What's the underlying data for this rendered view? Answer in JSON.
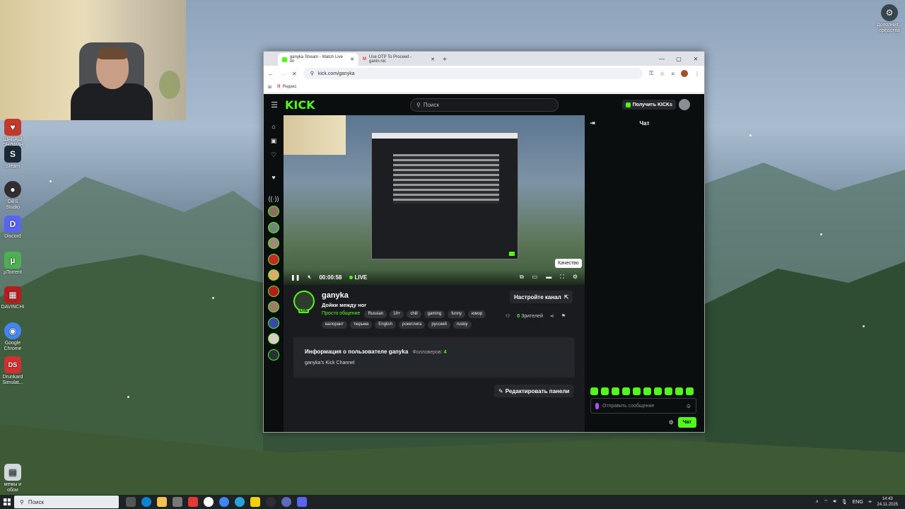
{
  "desktop": {
    "icons": [
      {
        "label": "ШАБАШ ОНЛАЙН",
        "color": "#c0392b",
        "glyph": "♥"
      },
      {
        "label": "Steam",
        "color": "#1b2838",
        "glyph": "S"
      },
      {
        "label": "OBS Studio",
        "color": "#302e31",
        "glyph": "●"
      },
      {
        "label": "Discord",
        "color": "#5865f2",
        "glyph": "D"
      },
      {
        "label": "µTorrent",
        "color": "#4caf50",
        "glyph": "µ"
      },
      {
        "label": "DAVINCHI",
        "color": "#b71c1c",
        "glyph": "▦"
      },
      {
        "label": "Google Chrome",
        "color": "#4285f4",
        "glyph": "◉"
      },
      {
        "label": "Drunkard Simulat...",
        "color": "#d32f2f",
        "glyph": "DS"
      },
      {
        "label": "мемы и обои",
        "color": "#cfd8dc",
        "glyph": "▤"
      },
      {
        "label": "Дополнит... средства",
        "color": "#37474f",
        "glyph": "⚙"
      }
    ]
  },
  "browser": {
    "tabs": [
      {
        "label": "ganyka Stream - Watch Live on",
        "favicon_color": "#53fc18"
      },
      {
        "label": "Use OTP To Proceed - ganin.nic",
        "favicon_color": "#ea4335"
      }
    ],
    "new_tab": "+",
    "window_controls": [
      "—",
      "▢",
      "✕"
    ],
    "url": "kick.com/ganyka",
    "bookmark": "Яндекс"
  },
  "kick": {
    "logo": "KICK",
    "search_placeholder": "Поиск",
    "get_kicks": "Получить KICKs",
    "player": {
      "time": "00:00:58",
      "live": "LIVE",
      "tooltip": "Качество"
    },
    "channel": {
      "name": "ganyka",
      "title": "Дойки между ног",
      "live_badge": "LIVE",
      "category": "Просто общение",
      "tags": [
        "Russian",
        "18+",
        "chill",
        "gaming",
        "funny",
        "юмор",
        "валорант",
        "тюрьма",
        "English",
        "рокетлига",
        "русский",
        "ruskiy"
      ],
      "setup_button": "Настройте канал",
      "viewers_count": "0",
      "viewers_label": "Зрителей"
    },
    "about": {
      "heading": "Информация о пользователе ganyka",
      "followers_label": "Фолловеров:",
      "followers_count": "4",
      "description": "ganyka's Kick Channel"
    },
    "edit_panels": "Редактировать панели",
    "chat": {
      "title": "Чат",
      "placeholder": "Отправить сообщение",
      "send": "Чат"
    }
  },
  "taskbar": {
    "search": "Поиск",
    "lang": "ENG",
    "time": "14:43",
    "date": "24.11.2025"
  }
}
